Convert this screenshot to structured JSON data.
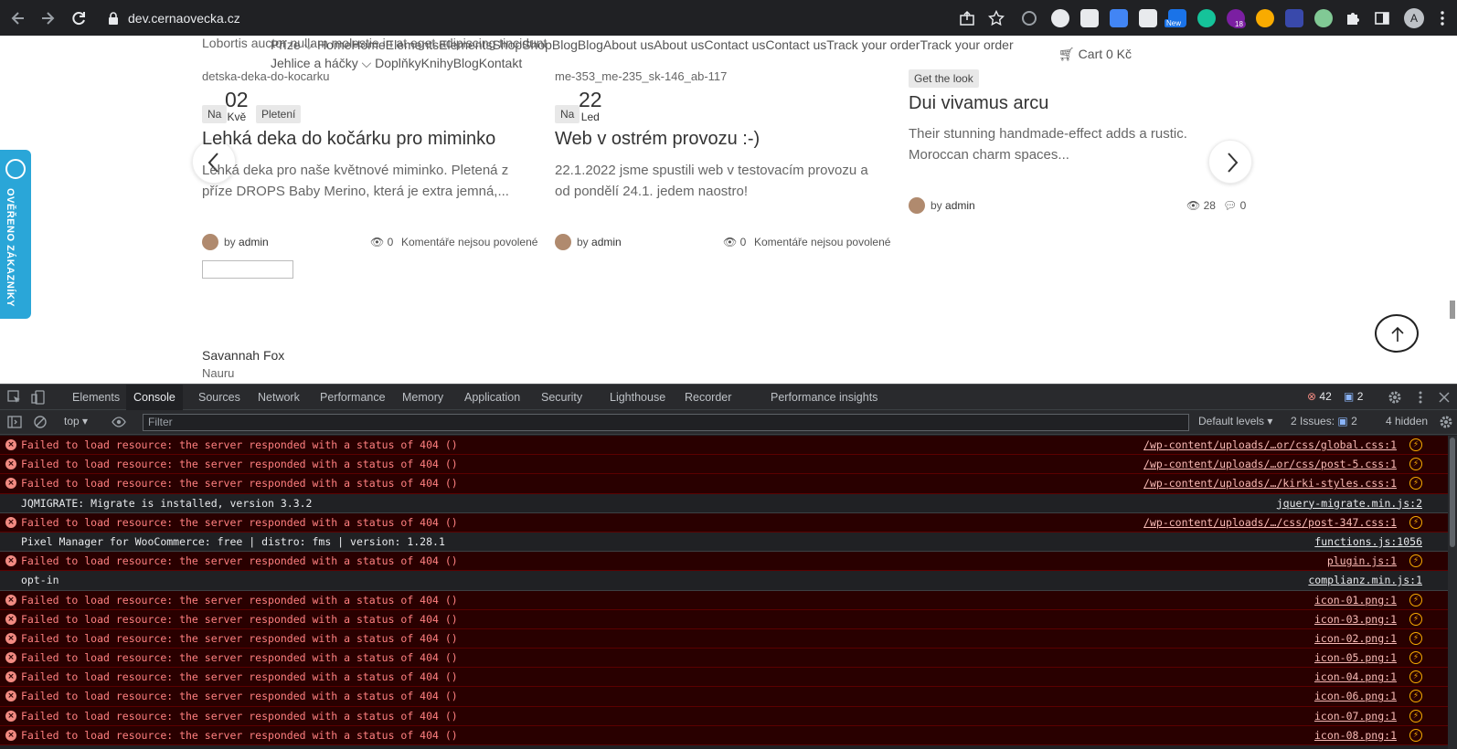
{
  "browser": {
    "url": "dev.cernaovecka.cz",
    "new_badge": "New",
    "ext_count": "18",
    "avatar_letter": "A"
  },
  "webpage": {
    "top_text": "Lobortis auctor nullam molestie in at eget adipiscing tincidunt",
    "menu_main": "Příze ⌵ HomeHomeElementsElementsShopShopBlogBlogAbout usAbout usContact usContact usTrack your orderTrack your order",
    "menu_sub": "Jehlice a háčky ⌵ DoplňkyKnihyBlogKontakt",
    "cart": "Cart 0 Kč",
    "side_badge": "OVĚŘENO ZÁKAZNÍKY",
    "posts": [
      {
        "img_alt": "detska-deka-do-kocarku",
        "date_day": "02",
        "date_month": "Kvě",
        "tag_prefix": "Na",
        "tag": "Pletení",
        "title": "Lehká deka do kočárku pro miminko",
        "excerpt_line1": "Lehká deka pro naše květnové miminko. Pletená z",
        "excerpt_line2": "příze DROPS Baby Merino, která je extra jemná,...",
        "author_prefix": "by",
        "author": "admin",
        "views": "0",
        "comments": "Komentáře nejsou povolené"
      },
      {
        "img_alt": "me-353_me-235_sk-146_ab-117",
        "date_day": "22",
        "date_month": "Led",
        "tag_prefix": "Na",
        "title": "Web v ostrém provozu :-)",
        "excerpt_line1": "22.1.2022 jsme spustili web v testovacím provozu a",
        "excerpt_line2": "od pondělí 24.1. jedem naostro!",
        "author_prefix": "by",
        "author": "admin",
        "views": "0",
        "comments": "Komentáře nejsou povolené"
      },
      {
        "tag": "Get the look",
        "title": "Dui vivamus arcu",
        "excerpt_line1": "Their stunning handmade-effect adds a rustic.",
        "excerpt_line2": "Moroccan charm spaces...",
        "author_prefix": "by",
        "author": "admin",
        "views": "28",
        "comments": "0"
      }
    ],
    "testimonial_name": "Savannah Fox",
    "testimonial_place": "Nauru"
  },
  "devtools": {
    "tabs": [
      "Elements",
      "Console",
      "Sources",
      "Network",
      "Performance",
      "Memory",
      "Application",
      "Security",
      "Lighthouse",
      "Recorder",
      "Performance insights"
    ],
    "active_tab": "Console",
    "error_count": "42",
    "message_count": "2",
    "context": "top",
    "filter_placeholder": "Filter",
    "levels": "Default levels",
    "issues_label": "2 Issues:",
    "issues_count": "2",
    "hidden": "4 hidden",
    "logs": [
      {
        "level": "error",
        "message": "Failed to load resource: the server responded with a status of 404 ()",
        "source": "/wp-content/uploads/…or/css/global.css:1"
      },
      {
        "level": "error",
        "message": "Failed to load resource: the server responded with a status of 404 ()",
        "source": "/wp-content/uploads/…or/css/post-5.css:1"
      },
      {
        "level": "error",
        "message": "Failed to load resource: the server responded with a status of 404 ()",
        "source": "/wp-content/uploads/…/kirki-styles.css:1"
      },
      {
        "level": "info",
        "message": "JQMIGRATE: Migrate is installed, version 3.3.2",
        "source": "jquery-migrate.min.js:2"
      },
      {
        "level": "error",
        "message": "Failed to load resource: the server responded with a status of 404 ()",
        "source": "/wp-content/uploads/…/css/post-347.css:1"
      },
      {
        "level": "info",
        "message": "Pixel Manager for WooCommerce: free | distro: fms | version: 1.28.1",
        "source": "functions.js:1056"
      },
      {
        "level": "error",
        "message": "Failed to load resource: the server responded with a status of 404 ()",
        "source": "plugin.js:1"
      },
      {
        "level": "info",
        "message": "opt-in",
        "source": "complianz.min.js:1"
      },
      {
        "level": "error",
        "message": "Failed to load resource: the server responded with a status of 404 ()",
        "source": "icon-01.png:1"
      },
      {
        "level": "error",
        "message": "Failed to load resource: the server responded with a status of 404 ()",
        "source": "icon-03.png:1"
      },
      {
        "level": "error",
        "message": "Failed to load resource: the server responded with a status of 404 ()",
        "source": "icon-02.png:1"
      },
      {
        "level": "error",
        "message": "Failed to load resource: the server responded with a status of 404 ()",
        "source": "icon-05.png:1"
      },
      {
        "level": "error",
        "message": "Failed to load resource: the server responded with a status of 404 ()",
        "source": "icon-04.png:1"
      },
      {
        "level": "error",
        "message": "Failed to load resource: the server responded with a status of 404 ()",
        "source": "icon-06.png:1"
      },
      {
        "level": "error",
        "message": "Failed to load resource: the server responded with a status of 404 ()",
        "source": "icon-07.png:1"
      },
      {
        "level": "error",
        "message": "Failed to load resource: the server responded with a status of 404 ()",
        "source": "icon-08.png:1"
      }
    ]
  },
  "colors": {
    "devtools_bg": "#202124",
    "error_row_bg": "#290000",
    "error_text": "#ff8080",
    "side_badge": "#2aa6d8"
  }
}
